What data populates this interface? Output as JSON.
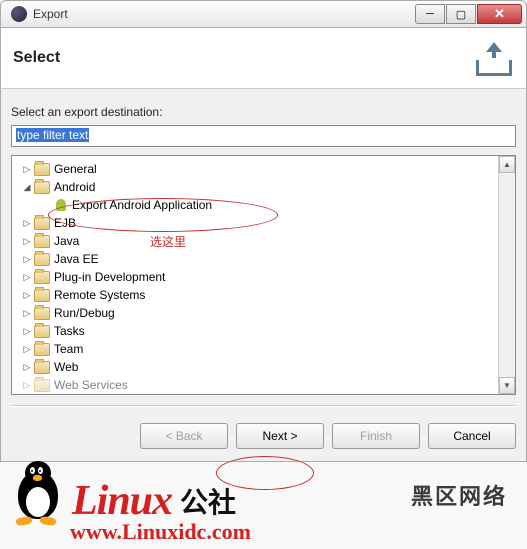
{
  "window": {
    "title": "Export"
  },
  "header": {
    "title": "Select"
  },
  "label": "Select an export destination:",
  "filter": {
    "text": "type filter text"
  },
  "tree": {
    "items": [
      {
        "label": "General",
        "expanded": false
      },
      {
        "label": "Android",
        "expanded": true,
        "children": [
          {
            "label": "Export Android Application",
            "icon": "android"
          }
        ]
      },
      {
        "label": "EJB",
        "expanded": false
      },
      {
        "label": "Java",
        "expanded": false
      },
      {
        "label": "Java EE",
        "expanded": false
      },
      {
        "label": "Plug-in Development",
        "expanded": false
      },
      {
        "label": "Remote Systems",
        "expanded": false
      },
      {
        "label": "Run/Debug",
        "expanded": false
      },
      {
        "label": "Tasks",
        "expanded": false
      },
      {
        "label": "Team",
        "expanded": false
      },
      {
        "label": "Web",
        "expanded": false
      },
      {
        "label": "Web Services",
        "expanded": false
      }
    ]
  },
  "buttons": {
    "back": "< Back",
    "next": "Next >",
    "finish": "Finish",
    "cancel": "Cancel"
  },
  "annotation": {
    "text": "选这里"
  },
  "watermark": {
    "brand": "Linux",
    "cn": "公社",
    "url": "www.Linuxidc.com",
    "gray": "黑区网络"
  }
}
